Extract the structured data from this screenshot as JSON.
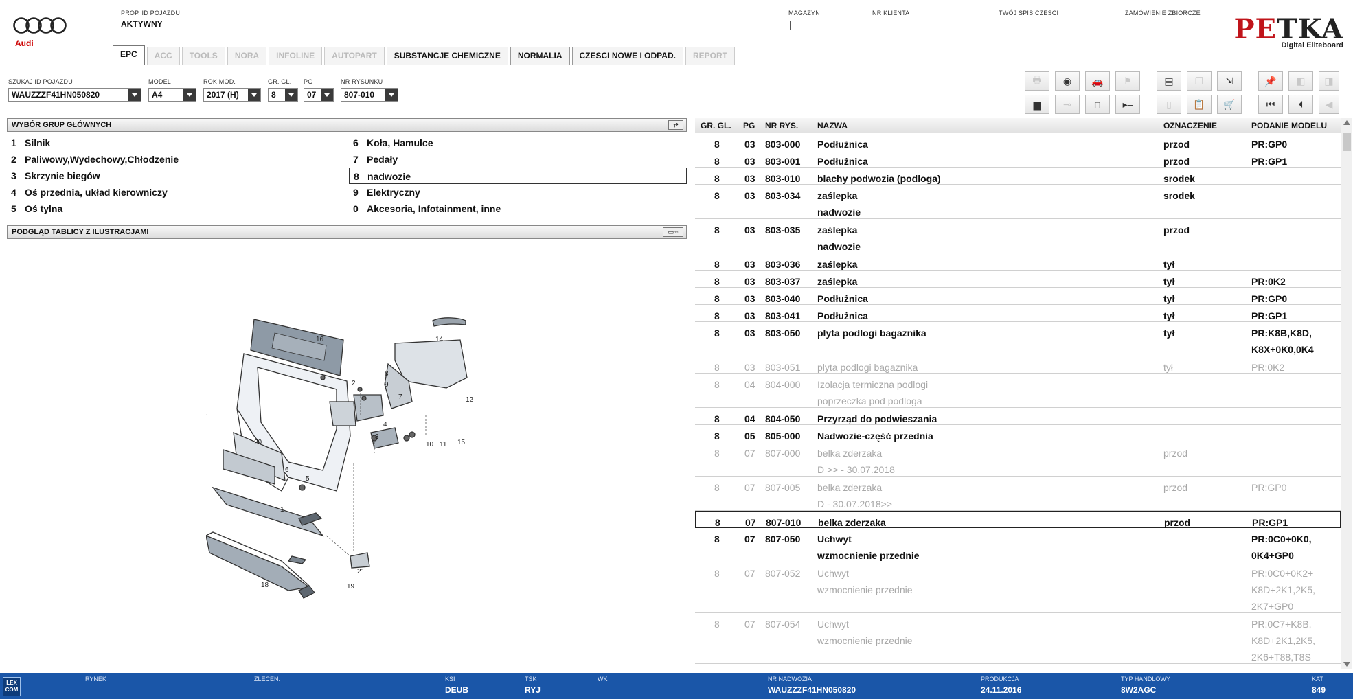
{
  "brand": {
    "name": "Audi",
    "app_name_a": "PE",
    "app_name_b": "TKA",
    "app_subtitle": "Digital Eliteboard"
  },
  "header": {
    "vehicle_id_label": "PROP. ID POJAZDU",
    "vehicle_id_value": "AKTYWNY",
    "magazyn_label": "MAGAZYN",
    "nr_klienta_label": "NR KLIENTA",
    "spis_label": "TWÓJ SPIS CZESCI",
    "zamowienie_label": "ZAMÓWIENIE ZBIORCZE"
  },
  "tabs": [
    {
      "label": "EPC",
      "state": "active"
    },
    {
      "label": "ACC",
      "state": "disabled"
    },
    {
      "label": "TOOLS",
      "state": "disabled"
    },
    {
      "label": "NORA",
      "state": "disabled"
    },
    {
      "label": "INFOLINE",
      "state": "disabled"
    },
    {
      "label": "AUTOPART",
      "state": "disabled"
    },
    {
      "label": "SUBSTANCJE CHEMICZNE",
      "state": "enabled"
    },
    {
      "label": "NORMALIA",
      "state": "enabled"
    },
    {
      "label": "CZESCI NOWE I ODPAD.",
      "state": "enabled"
    },
    {
      "label": "REPORT",
      "state": "disabled"
    }
  ],
  "filters": {
    "search_label": "SZUKAJ ID POJAZDU",
    "search_value": "WAUZZZF41HN050820",
    "model_label": "MODEL",
    "model_value": "A4",
    "year_label": "ROK MOD.",
    "year_value": "2017 (H)",
    "gr_label": "GR. GL.",
    "gr_value": "8",
    "pg_label": "PG",
    "pg_value": "07",
    "nr_label": "NR RYSUNKU",
    "nr_value": "807-010"
  },
  "groups_panel": {
    "title": "WYBÓR GRUP GŁÓWNYCH",
    "items": [
      {
        "num": "1",
        "label": "Silnik"
      },
      {
        "num": "2",
        "label": "Paliwowy,Wydechowy,Chłodzenie"
      },
      {
        "num": "3",
        "label": "Skrzynie biegów"
      },
      {
        "num": "4",
        "label": "Oś przednia, układ kierowniczy"
      },
      {
        "num": "5",
        "label": "Oś tylna"
      },
      {
        "num": "6",
        "label": "Koła, Hamulce"
      },
      {
        "num": "7",
        "label": "Pedały"
      },
      {
        "num": "8",
        "label": "nadwozie"
      },
      {
        "num": "9",
        "label": "Elektryczny"
      },
      {
        "num": "0",
        "label": "Akcesoria, Infotainment, inne"
      }
    ]
  },
  "illustration_panel": {
    "title": "PODGLĄD TABLICY Z ILUSTRACJAMI",
    "callouts": [
      "16",
      "2",
      "8",
      "9",
      "14",
      "7",
      "12",
      "3",
      "4",
      "10",
      "11",
      "15",
      "5",
      "20",
      "6",
      "1",
      "21",
      "18",
      "19"
    ]
  },
  "parts_table": {
    "headers": {
      "gr": "GR. GL.",
      "pg": "PG",
      "nr": "NR RYS.",
      "name": "NAZWA",
      "ozn": "OZNACZENIE",
      "pod": "PODANIE MODELU"
    },
    "rows": [
      {
        "gr": "8",
        "pg": "03",
        "nr": "803-000",
        "name": "Podłużnica",
        "name2": "",
        "ozn": "przod",
        "pod": "PR:GP0",
        "pod2": "",
        "pod3": "",
        "state": "normal"
      },
      {
        "gr": "8",
        "pg": "03",
        "nr": "803-001",
        "name": "Podłużnica",
        "name2": "",
        "ozn": "przod",
        "pod": "PR:GP1",
        "pod2": "",
        "pod3": "",
        "state": "normal"
      },
      {
        "gr": "8",
        "pg": "03",
        "nr": "803-010",
        "name": "blachy podwozia (podloga)",
        "name2": "",
        "ozn": "srodek",
        "pod": "",
        "pod2": "",
        "pod3": "",
        "state": "normal"
      },
      {
        "gr": "8",
        "pg": "03",
        "nr": "803-034",
        "name": "zaślepka",
        "name2": "nadwozie",
        "ozn": "srodek",
        "pod": "",
        "pod2": "",
        "pod3": "",
        "state": "normal"
      },
      {
        "gr": "8",
        "pg": "03",
        "nr": "803-035",
        "name": "zaślepka",
        "name2": "nadwozie",
        "ozn": "przod",
        "pod": "",
        "pod2": "",
        "pod3": "",
        "state": "normal"
      },
      {
        "gr": "8",
        "pg": "03",
        "nr": "803-036",
        "name": "zaślepka",
        "name2": "",
        "ozn": "tył",
        "pod": "",
        "pod2": "",
        "pod3": "",
        "state": "normal"
      },
      {
        "gr": "8",
        "pg": "03",
        "nr": "803-037",
        "name": "zaślepka",
        "name2": "",
        "ozn": "tył",
        "pod": "PR:0K2",
        "pod2": "",
        "pod3": "",
        "state": "normal"
      },
      {
        "gr": "8",
        "pg": "03",
        "nr": "803-040",
        "name": "Podłużnica",
        "name2": "",
        "ozn": "tył",
        "pod": "PR:GP0",
        "pod2": "",
        "pod3": "",
        "state": "normal"
      },
      {
        "gr": "8",
        "pg": "03",
        "nr": "803-041",
        "name": "Podłużnica",
        "name2": "",
        "ozn": "tył",
        "pod": "PR:GP1",
        "pod2": "",
        "pod3": "",
        "state": "normal"
      },
      {
        "gr": "8",
        "pg": "03",
        "nr": "803-050",
        "name": "plyta podlogi bagaznika",
        "name2": "",
        "ozn": "tył",
        "pod": "PR:K8B,K8D,",
        "pod2": "K8X+0K0,0K4",
        "pod3": "",
        "state": "normal"
      },
      {
        "gr": "8",
        "pg": "03",
        "nr": "803-051",
        "name": "plyta podlogi bagaznika",
        "name2": "",
        "ozn": "tył",
        "pod": "PR:0K2",
        "pod2": "",
        "pod3": "",
        "state": "grey"
      },
      {
        "gr": "8",
        "pg": "04",
        "nr": "804-000",
        "name": "Izolacja termiczna podlogi",
        "name2": "poprzeczka pod podloga",
        "ozn": "",
        "pod": "",
        "pod2": "",
        "pod3": "",
        "state": "grey"
      },
      {
        "gr": "8",
        "pg": "04",
        "nr": "804-050",
        "name": "Przyrząd do podwieszania",
        "name2": "",
        "ozn": "",
        "pod": "",
        "pod2": "",
        "pod3": "",
        "state": "normal"
      },
      {
        "gr": "8",
        "pg": "05",
        "nr": "805-000",
        "name": "Nadwozie-część przednia",
        "name2": "",
        "ozn": "",
        "pod": "",
        "pod2": "",
        "pod3": "",
        "state": "normal"
      },
      {
        "gr": "8",
        "pg": "07",
        "nr": "807-000",
        "name": "belka zderzaka",
        "name2": "D            >> - 30.07.2018",
        "ozn": "przod",
        "pod": "",
        "pod2": "",
        "pod3": "",
        "state": "grey"
      },
      {
        "gr": "8",
        "pg": "07",
        "nr": "807-005",
        "name": "belka zderzaka",
        "name2": "D - 30.07.2018>>",
        "ozn": "przod",
        "pod": "PR:GP0",
        "pod2": "",
        "pod3": "",
        "state": "grey"
      },
      {
        "gr": "8",
        "pg": "07",
        "nr": "807-010",
        "name": "belka zderzaka",
        "name2": "",
        "ozn": "przod",
        "pod": "PR:GP1",
        "pod2": "",
        "pod3": "",
        "state": "sel"
      },
      {
        "gr": "8",
        "pg": "07",
        "nr": "807-050",
        "name": "Uchwyt",
        "name2": "wzmocnienie przednie",
        "ozn": "",
        "pod": "PR:0C0+0K0,",
        "pod2": "0K4+GP0",
        "pod3": "",
        "state": "normal"
      },
      {
        "gr": "8",
        "pg": "07",
        "nr": "807-052",
        "name": "Uchwyt",
        "name2": "wzmocnienie przednie",
        "ozn": "",
        "pod": "PR:0C0+0K2+",
        "pod2": "K8D+2K1,2K5,",
        "pod3": "2K7+GP0",
        "state": "grey"
      },
      {
        "gr": "8",
        "pg": "07",
        "nr": "807-054",
        "name": "Uchwyt",
        "name2": "wzmocnienie przednie",
        "ozn": "",
        "pod": "PR:0C7+K8B,",
        "pod2": "K8D+2K1,2K5,",
        "pod3": "2K6+T88,T8S",
        "state": "grey"
      }
    ]
  },
  "toolbar_icons": [
    "print-icon",
    "user-badge-icon",
    "car-icon",
    "flag-icon",
    "kennz-icon",
    "doc-copy-icon",
    "cart-export-icon",
    "pin-icon",
    "doc-prev-icon",
    "doc-next-icon",
    "monitor-icon",
    "toggle-icon",
    "car-lift-icon",
    "play-dash-icon",
    "phone-doc-icon",
    "clipboard-icon",
    "cart-icon",
    "first-icon",
    "prev-icon",
    "back-icon"
  ],
  "status_bar": {
    "logo": "LEX COM",
    "rynek_label": "RYNEK",
    "rynek_value": "",
    "zlecen_label": "ZLECEN.",
    "zlecen_value": "",
    "ksi_label": "KSI",
    "ksi_value": "DEUB",
    "tsk_label": "TSK",
    "tsk_value": "RYJ",
    "wk_label": "WK",
    "wk_value": "",
    "nadwozie_label": "NR NADWOZIA",
    "nadwozie_value": "WAUZZZF41HN050820",
    "produkcja_label": "PRODUKCJA",
    "produkcja_value": "24.11.2016",
    "typ_label": "TYP HANDLOWY",
    "typ_value": "8W2AGC",
    "kat_label": "KAT",
    "kat_value": "849"
  }
}
